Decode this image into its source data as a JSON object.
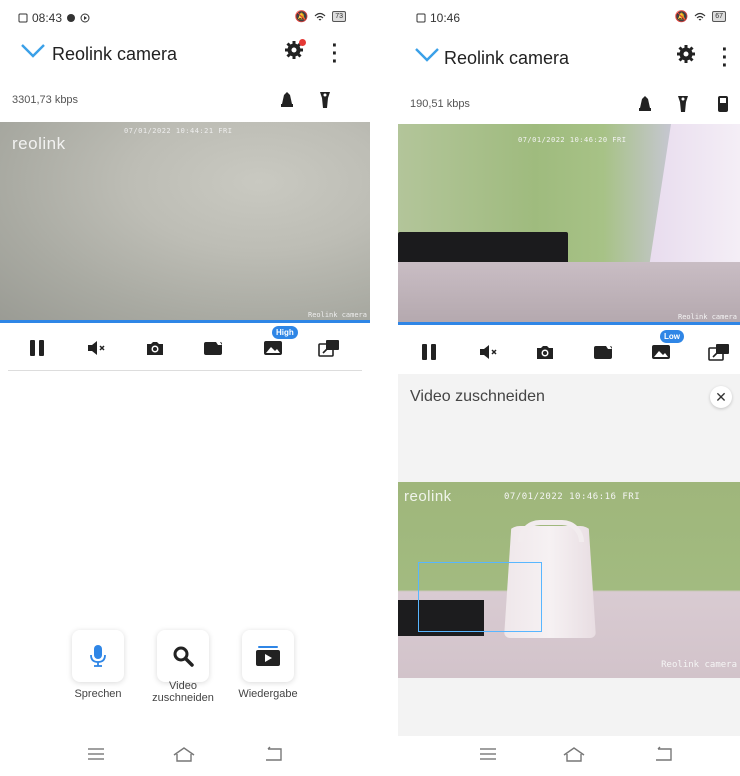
{
  "left": {
    "status": {
      "time": "08:43",
      "battery": "73"
    },
    "camera_title": "Reolink camera",
    "bitrate": "3301,73 kbps",
    "video": {
      "timestamp": "07/01/2022 10:44:21 FRI",
      "brand": "reolink",
      "watermark": "Reolink camera"
    },
    "quality_badge": "High",
    "actions": [
      {
        "label": "Sprechen",
        "icon": "microphone-icon"
      },
      {
        "label": "Video\nzuschneiden",
        "icon": "magnifier-icon"
      },
      {
        "label": "Wiedergabe",
        "icon": "playback-icon"
      }
    ]
  },
  "right": {
    "status": {
      "time": "10:46",
      "battery": "67"
    },
    "camera_title": "Reolink camera",
    "bitrate": "190,51 kbps",
    "video": {
      "timestamp": "07/01/2022 10:46:20 FRI",
      "watermark": "Reolink camera"
    },
    "quality_badge": "Low",
    "crop_title": "Video zuschneiden",
    "crop_video": {
      "timestamp": "07/01/2022 10:46:16 FRI",
      "brand": "reolink",
      "watermark": "Reolink camera"
    }
  },
  "colors": {
    "accent": "#2f86e6",
    "chevron": "#3aa0e8",
    "notify_dot": "#e53935"
  }
}
